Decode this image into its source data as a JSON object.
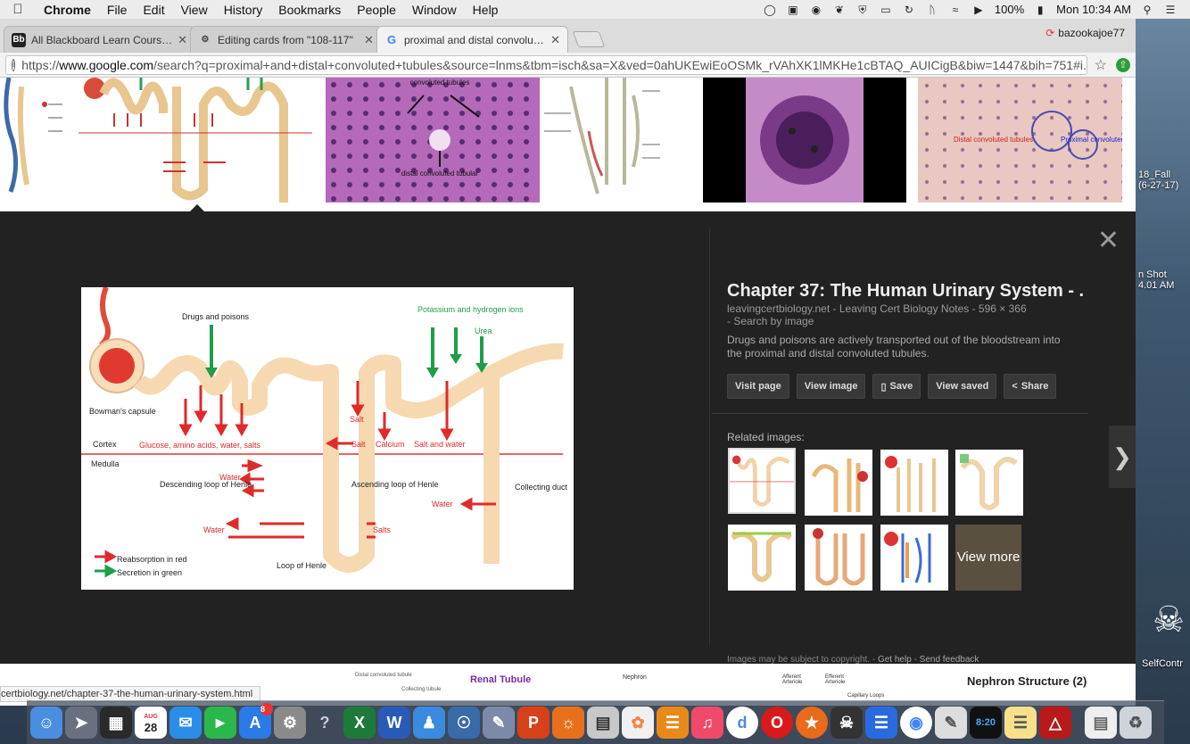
{
  "menubar": {
    "app": "Chrome",
    "items": [
      "File",
      "Edit",
      "View",
      "History",
      "Bookmarks",
      "People",
      "Window",
      "Help"
    ],
    "battery": "100%",
    "clock": "Mon 10:34 AM"
  },
  "tabs": [
    {
      "title": "All Blackboard Learn Courses -",
      "favicon": "Bb",
      "color": "#222"
    },
    {
      "title": "Editing cards from \"108-117\"",
      "favicon": "⚙",
      "color": "#444"
    },
    {
      "title": "proximal and distal convoluted",
      "favicon": "G",
      "color": "#4285f4"
    }
  ],
  "profile": "bazookajoe77",
  "address": {
    "prefix": "https://",
    "host": "www.google.com",
    "path": "/search?q=proximal+and+distal+convoluted+tubules&source=lnms&tbm=isch&sa=X&ved=0ahUKEwiEoOSMk_rVAhXK1lMKHe1cBTAQ_AUICigB&biw=1447&bih=751#i..."
  },
  "viewer": {
    "title": "Chapter 37: The Human Urinary System - ...",
    "source": "leavingcertbiology.net - Leaving Cert Biology Notes - 596 × 366",
    "search_by_image": "- Search by image",
    "description": "Drugs and poisons are actively transported out of the bloodstream into the proximal and distal convoluted tubules.",
    "buttons": {
      "visit": "Visit page",
      "view_image": "View image",
      "save": "Save",
      "view_saved": "View saved",
      "share": "Share"
    },
    "related_label": "Related images:",
    "view_more": "View more",
    "footer": "Images may be subject to copyright.",
    "get_help": "Get help",
    "send_feedback": "Send feedback"
  },
  "diagram": {
    "drugs": "Drugs and poisons",
    "potassium": "Potassium and hydrogen ions",
    "urea": "Urea",
    "bowman": "Bowman's capsule",
    "cortex": "Cortex",
    "medulla": "Medulla",
    "glucose": "Glucose, amino acids, water, salts",
    "salt1": "Salt",
    "salt2": "Salt",
    "calcium": "Calcium",
    "salt_water": "Salt and water",
    "water1": "Water",
    "water2": "Water",
    "water3": "Water",
    "salts": "Salts",
    "descending": "Descending loop of Henle",
    "ascending": "Ascending loop of Henle",
    "collecting": "Collecting duct",
    "loop": "Loop of Henle",
    "reabsorption": "Reabsorption in red",
    "secretion": "Secretion in green"
  },
  "strip": {
    "thumb2_label": "distal convoluted tubular",
    "thumb2_top": "convoluted tubules",
    "thumb6_a": "Distal convoluted tubules",
    "thumb6_b": "Proximal convoluted tubules"
  },
  "bottom": {
    "status_url": "certbiology.net/chapter-37-the-human-urinary-system.html",
    "renal": "Renal Tubule",
    "nephron": "Nephron Structure (2)",
    "small_nephron": "Nephron",
    "afferent": "Afferent Arteriole",
    "efferent": "Efferent Arteriole",
    "capillary": "Capillary Loops",
    "distal": "Distal convoluted tubule",
    "collecting": "Collecting tubule"
  },
  "desktop": {
    "file1": "18_Fall",
    "file1b": "(6-27-17)",
    "shot": "n Shot",
    "shot_time": "4.01 AM",
    "selfcontrol": "SelfContr"
  },
  "dock_badge": "8",
  "dock_date": "28",
  "dock_date_month": "AUG",
  "dock_clock": "8:20"
}
